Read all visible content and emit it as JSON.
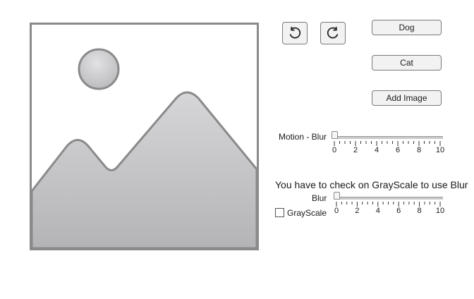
{
  "toolbar": {
    "undo_icon": "rotate-counterclockwise-icon",
    "redo_icon": "rotate-clockwise-icon"
  },
  "buttons": {
    "dog": "Dog",
    "cat": "Cat",
    "add_image": "Add Image"
  },
  "preview": {
    "icon": "image-placeholder-icon"
  },
  "motion_blur": {
    "label": "Motion - Blur",
    "value": 0,
    "min": 0,
    "max": 10,
    "tick_labels": [
      "0",
      "2",
      "4",
      "6",
      "8",
      "10"
    ]
  },
  "grayscale_note": "You have to check on GrayScale to use Blur",
  "blur": {
    "label": "Blur",
    "value": 0,
    "min": 0,
    "max": 10,
    "tick_labels": [
      "0",
      "2",
      "4",
      "6",
      "8",
      "10"
    ]
  },
  "grayscale": {
    "label": "GrayScale",
    "checked": false
  },
  "colors": {
    "frame_border": "#8a8a8a",
    "mountain_fill": "#c4c4c6",
    "sun_fill": "#c9c9cb"
  }
}
